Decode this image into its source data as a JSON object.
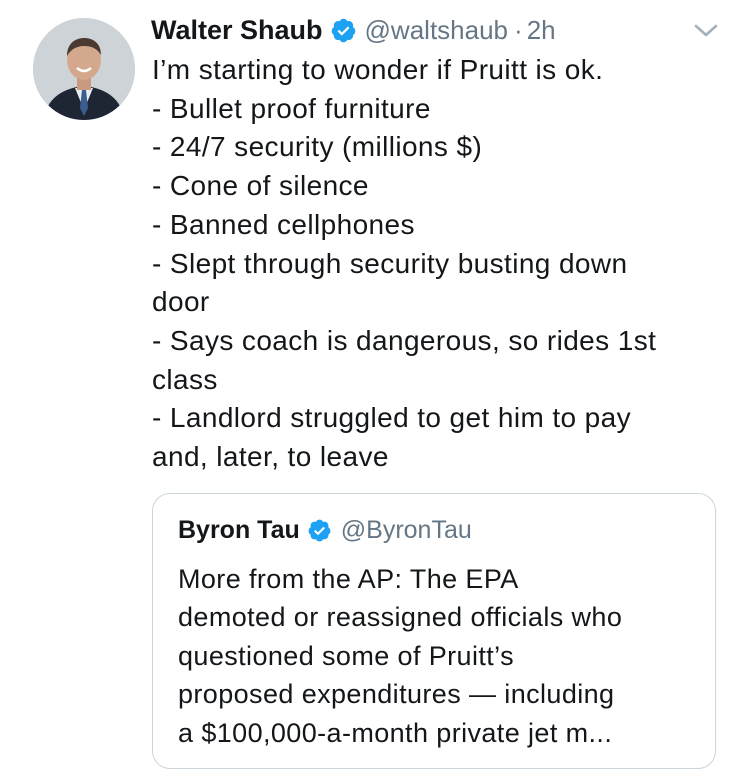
{
  "tweet": {
    "author": {
      "name": "Walter Shaub",
      "handle": "@waltshaub",
      "verified": true
    },
    "separator": "·",
    "time": "2h",
    "menu_icon": "chevron-down-icon",
    "text_lines": [
      "I’m starting to wonder if Pruitt is ok.",
      "- Bullet proof furniture",
      "- 24/7 security (millions $)",
      "- Cone of silence",
      "- Banned cellphones",
      "- Slept through security busting down",
      "door",
      "- Says coach is dangerous, so rides 1st",
      "class",
      "- Landlord struggled to get him to pay",
      "and, later, to leave"
    ]
  },
  "quoted_tweet": {
    "author": {
      "name": "Byron Tau",
      "handle": "@ByronTau",
      "verified": true
    },
    "text_lines": [
      "More from the AP: The EPA",
      "demoted or reassigned officials who",
      "questioned some of Pruitt’s",
      "proposed expenditures — including",
      "a $100,000-a-month private jet m..."
    ]
  },
  "colors": {
    "text": "#14171a",
    "secondary": "#657786",
    "verified_blue": "#1da1f2",
    "border": "#ccd6dd"
  }
}
